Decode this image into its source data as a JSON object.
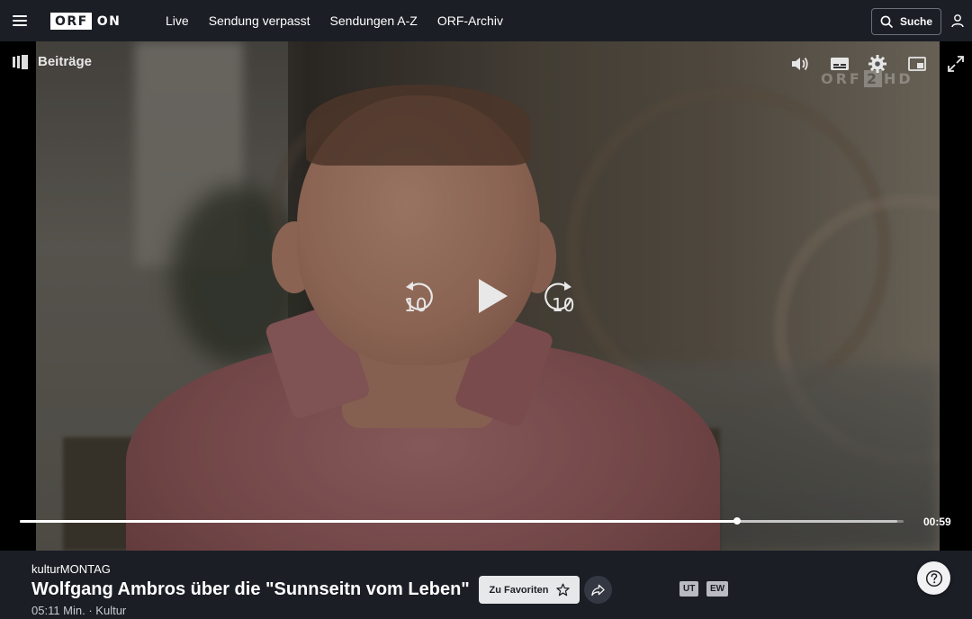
{
  "header": {
    "logo_box": "ORF",
    "logo_suffix": "ON",
    "nav": [
      "Live",
      "Sendung verpasst",
      "Sendungen A-Z",
      "ORF-Archiv"
    ],
    "search_label": "Suche"
  },
  "player": {
    "beitraege_label": "Beiträge",
    "watermark": {
      "text": "ORF",
      "channel": "2",
      "hd": "HD"
    },
    "rewind_seconds": "10",
    "forward_seconds": "10",
    "time_display": "00:59",
    "progress_fraction": 0.8117,
    "buffer_fraction": 0.9925
  },
  "info": {
    "series": "kulturMONTAG",
    "title": "Wolfgang Ambros über die \"Sunnseitn vom Leben\"",
    "meta": "05:11 Min. · Kultur",
    "favorite_label": "Zu Favoriten",
    "tags": [
      "UT",
      "EW"
    ]
  },
  "colors": {
    "background": "#1b1e25",
    "button_light": "#e7e8ea",
    "tag_bg": "#b9bbc1"
  },
  "icons": [
    "menu-icon",
    "search-icon",
    "user-icon",
    "playlist-icon",
    "volume-icon",
    "subtitles-icon",
    "settings-icon",
    "picture-in-picture-icon",
    "fullscreen-icon",
    "rewind-10-icon",
    "play-icon",
    "forward-10-icon",
    "star-icon",
    "share-icon",
    "help-icon"
  ]
}
